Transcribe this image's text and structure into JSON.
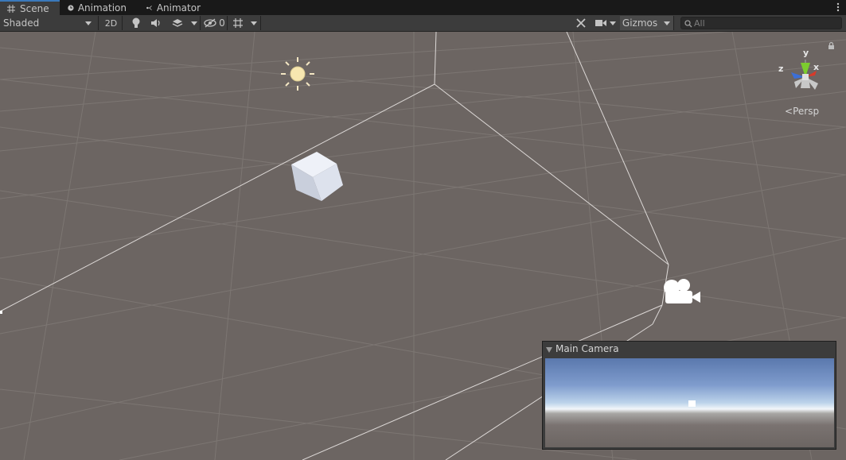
{
  "tabs": [
    {
      "label": "Scene",
      "icon": "grid-icon",
      "active": true
    },
    {
      "label": "Animation",
      "icon": "clock-icon",
      "active": false
    },
    {
      "label": "Animator",
      "icon": "animator-icon",
      "active": false
    }
  ],
  "toolbar": {
    "draw_mode": "Shaded",
    "mode_2d": "2D",
    "hidden_count": "0",
    "gizmos": "Gizmos",
    "search_placeholder": "All"
  },
  "viewport": {
    "projection_label": "Persp",
    "axes": {
      "x": "x",
      "y": "y",
      "z": "z"
    }
  },
  "camera_preview": {
    "title": "Main Camera"
  },
  "colors": {
    "viewport_bg": "#6c6562",
    "toolbar_bg": "#3c3c3c",
    "tabbar_bg": "#191919",
    "accent": "#3a79bb"
  }
}
